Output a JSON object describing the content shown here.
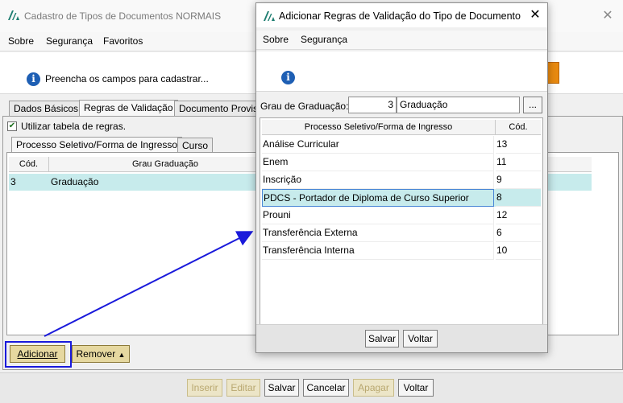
{
  "main_window": {
    "title": "Cadastro de Tipos de Documentos NORMAIS",
    "close_glyph": "✕",
    "menu": [
      "Sobre",
      "Segurança",
      "Favoritos"
    ],
    "info_text": "Preencha os campos para cadastrar...",
    "tabs": [
      "Dados Básicos",
      "Regras de Validação",
      "Documento Provis"
    ],
    "use_rules_label": "Utilizar tabela de regras.",
    "subtabs": [
      "Processo Seletivo/Forma de Ingresso",
      "Curso"
    ],
    "grid": {
      "columns": [
        "Cód.",
        "Grau Graduação"
      ],
      "rows": [
        {
          "code": "3",
          "name": "Graduação"
        }
      ]
    },
    "add_button": "Adicionar",
    "remove_button": "Remover",
    "toolbar": [
      "Inserir",
      "Editar",
      "Salvar",
      "Cancelar",
      "Apagar",
      "Voltar"
    ]
  },
  "dialog": {
    "title": "Adicionar Regras de Validação do Tipo de Documento",
    "close_glyph": "✕",
    "menu": [
      "Sobre",
      "Segurança"
    ],
    "grau_label": "Grau de Graduação:",
    "grau_code": "3",
    "grau_name": "Graduação",
    "lookup_button": "...",
    "grid": {
      "columns": [
        "Processo Seletivo/Forma de Ingresso",
        "Cód."
      ],
      "rows": [
        {
          "name": "Análise Curricular",
          "code": "13"
        },
        {
          "name": "Enem",
          "code": "11"
        },
        {
          "name": "Inscrição",
          "code": "9"
        },
        {
          "name": "PDCS - Portador de Diploma de Curso Superior",
          "code": "8"
        },
        {
          "name": "Prouni",
          "code": "12"
        },
        {
          "name": "Transferência Externa",
          "code": "6"
        },
        {
          "name": "Transferência Interna",
          "code": "10"
        }
      ],
      "selected_row": 3
    },
    "save_button": "Salvar",
    "back_button": "Voltar"
  },
  "colors": {
    "highlight_row": "#c7ebec",
    "annotation_blue": "#1a1adb",
    "button_gold": "#e6d8a0",
    "info_icon_blue": "#1e5fb4",
    "logo_green": "#1d7d70"
  },
  "icons": [
    "app-logo-icon",
    "close-icon",
    "info-icon",
    "check-icon",
    "triangle-up-icon",
    "arrow-annotation"
  ]
}
